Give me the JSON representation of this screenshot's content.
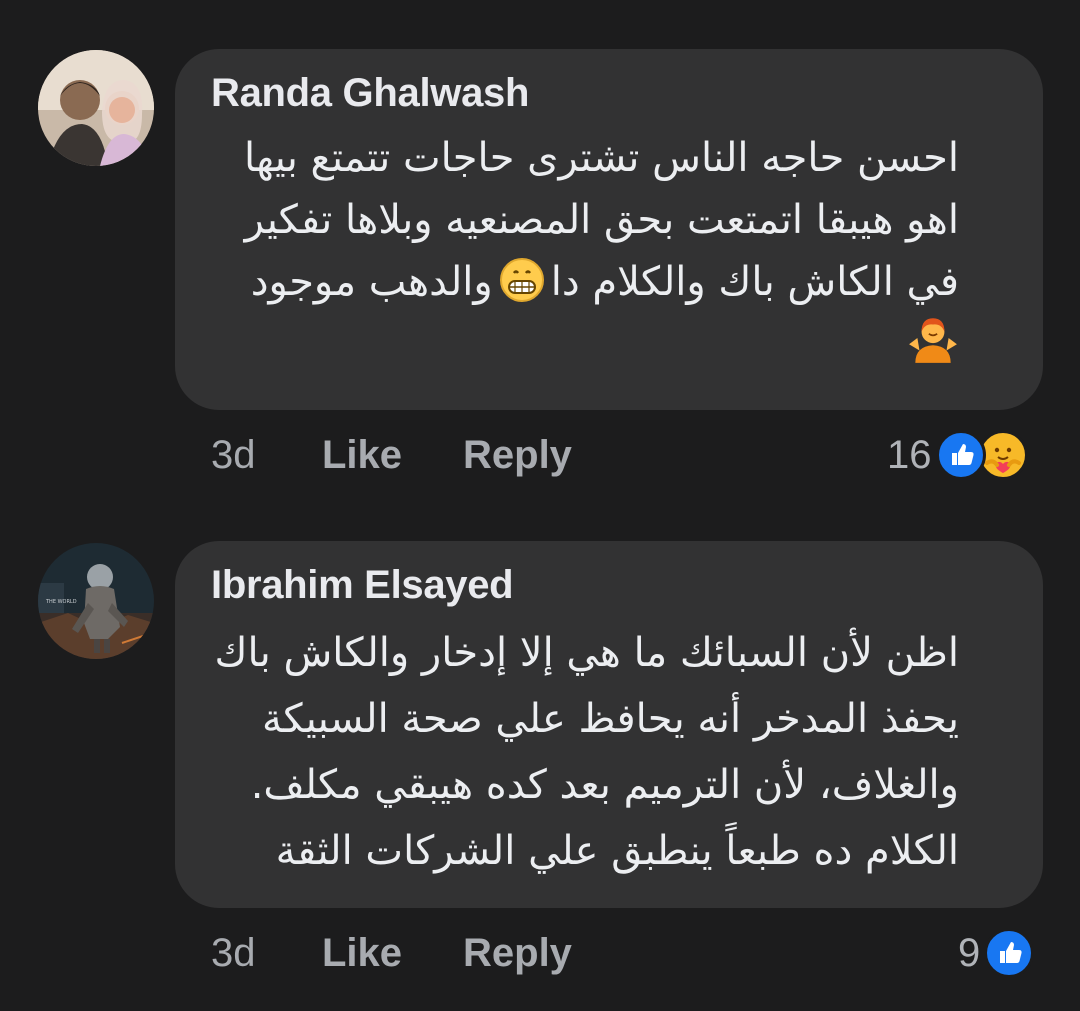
{
  "comments": [
    {
      "author": "Randa Ghalwash",
      "lines": [
        "احسن حاجه الناس تشترى حاجات تتمتع بيها",
        "اهو هيبقا اتمتعت بحق المصنعيه وبلاها تفكير",
        "في الكاش باك والكلام دا",
        "والدهب موجود"
      ],
      "emoji_1": "grinning-face-emoji",
      "emoji_2": "person-shrugging-emoji",
      "time": "3d",
      "like_label": "Like",
      "reply_label": "Reply",
      "reaction_count": "16",
      "reactions": [
        "like-reaction-icon",
        "care-reaction-icon"
      ]
    },
    {
      "author": "Ibrahim Elsayed",
      "lines": [
        "اظن لأن السبائك ما هي إلا إدخار والكاش باك",
        "يحفذ المدخر أنه يحافظ علي صحة السبيكة",
        "والغلاف، لأن الترميم بعد كده هيبقي مكلف.",
        "الكلام ده طبعاً ينطبق علي الشركات الثقة"
      ],
      "time": "3d",
      "like_label": "Like",
      "reply_label": "Reply",
      "reaction_count": "9",
      "reactions": [
        "like-reaction-icon"
      ]
    }
  ],
  "colors": {
    "background": "#1c1c1d",
    "bubble": "#323233",
    "like_blue": "#1877f2",
    "care_yellow": "#f7b928"
  }
}
